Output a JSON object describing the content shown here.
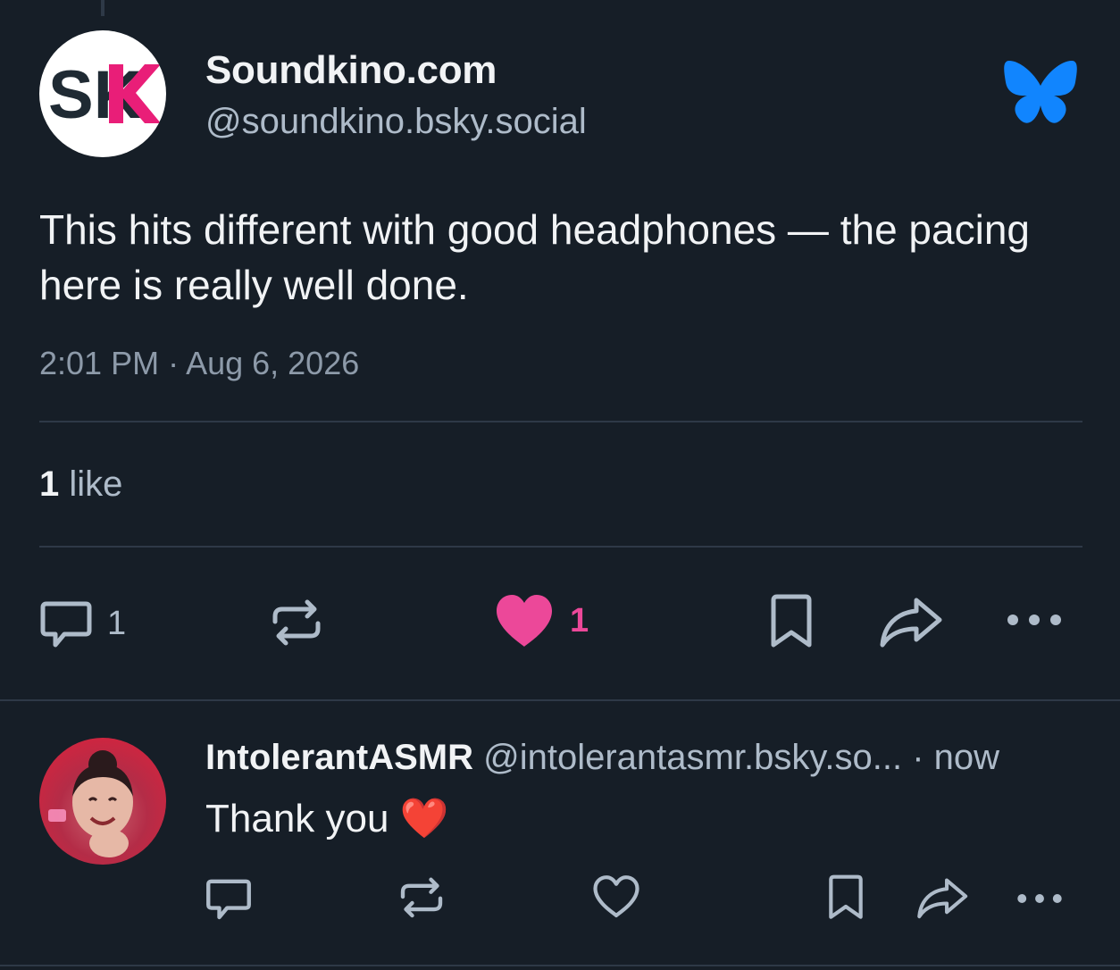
{
  "post": {
    "author": {
      "display_name": "Soundkino.com",
      "handle": "@soundkino.bsky.social",
      "avatar_initials": "SK"
    },
    "text": "This hits different with good headphones — the pacing here is really well done.",
    "timestamp": "2:01 PM · Aug 6, 2026",
    "likes_summary": {
      "count": "1",
      "label": "like"
    },
    "actions": {
      "reply_count": "1",
      "repost_count": "",
      "like_count": "1",
      "liked": true
    }
  },
  "reply": {
    "author": {
      "display_name": "IntolerantASMR",
      "handle": "@intolerantasmr.bsky.so...",
      "time": "· now"
    },
    "text": "Thank you ❤️"
  },
  "colors": {
    "background": "#161e27",
    "divider": "#2e3947",
    "muted_text": "#aebbc9",
    "icon": "#aebbc9",
    "like_pink": "#ec4899",
    "bluesky_blue": "#1185fe"
  }
}
